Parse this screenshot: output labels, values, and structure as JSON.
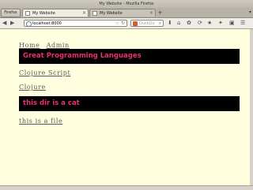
{
  "window": {
    "title": "My Website - Mozilla Firefox"
  },
  "browser": {
    "menu_button": "Firefox",
    "tabs": [
      {
        "label": "My Website",
        "active": true
      },
      {
        "label": "My Website",
        "active": false
      }
    ],
    "new_tab": "+",
    "url": "localhost:8000",
    "search_placeholder": "DuckDu"
  },
  "page": {
    "nav_links": [
      "Home",
      "Admin"
    ],
    "heading": "Great Programming Languages",
    "links": [
      "Clojure Script",
      "Clojure"
    ],
    "dir_banner": "this dir is a cat",
    "file_link": "this is a file"
  },
  "colors": {
    "page_background": "#ffffe0",
    "banner_background": "#000000",
    "banner_text": "#e8336a",
    "link": "#5a5a5a"
  }
}
